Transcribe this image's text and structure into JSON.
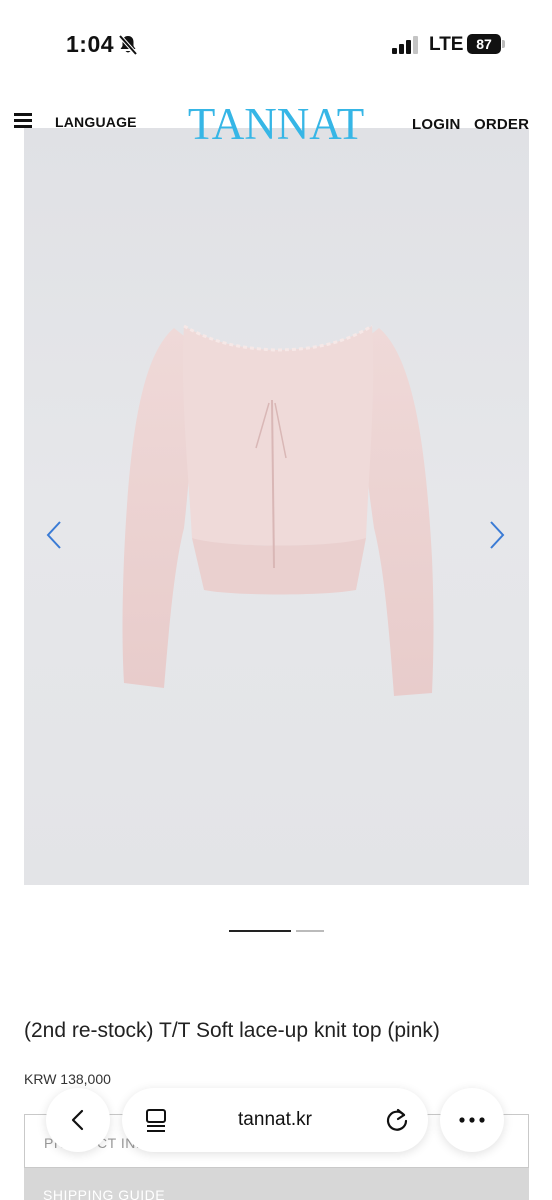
{
  "status_bar": {
    "time": "1:04",
    "network": "LTE",
    "battery": "87"
  },
  "header": {
    "language_label": "LANGUAGE",
    "logo": "TANNAT",
    "login_label": "LOGIN",
    "order_label": "ORDER"
  },
  "product": {
    "title": "(2nd re-stock) T/T Soft lace-up knit top (pink)",
    "price": "KRW 138,000",
    "image_count": 2,
    "current_image": 1
  },
  "accordion": {
    "info_label": "PRODUCT INFO",
    "shipping_label": "SHIPPING GUIDE"
  },
  "browser": {
    "url": "tannat.kr"
  },
  "colors": {
    "logo": "#36b6e6",
    "arrow": "#3a7bd5",
    "garment": "#ecd2d0"
  },
  "icons": [
    "bell-slash-icon",
    "signal-icon",
    "menu-icon",
    "chevron-left-icon",
    "chevron-right-icon",
    "back-icon",
    "tabs-icon",
    "reload-icon",
    "more-icon"
  ]
}
